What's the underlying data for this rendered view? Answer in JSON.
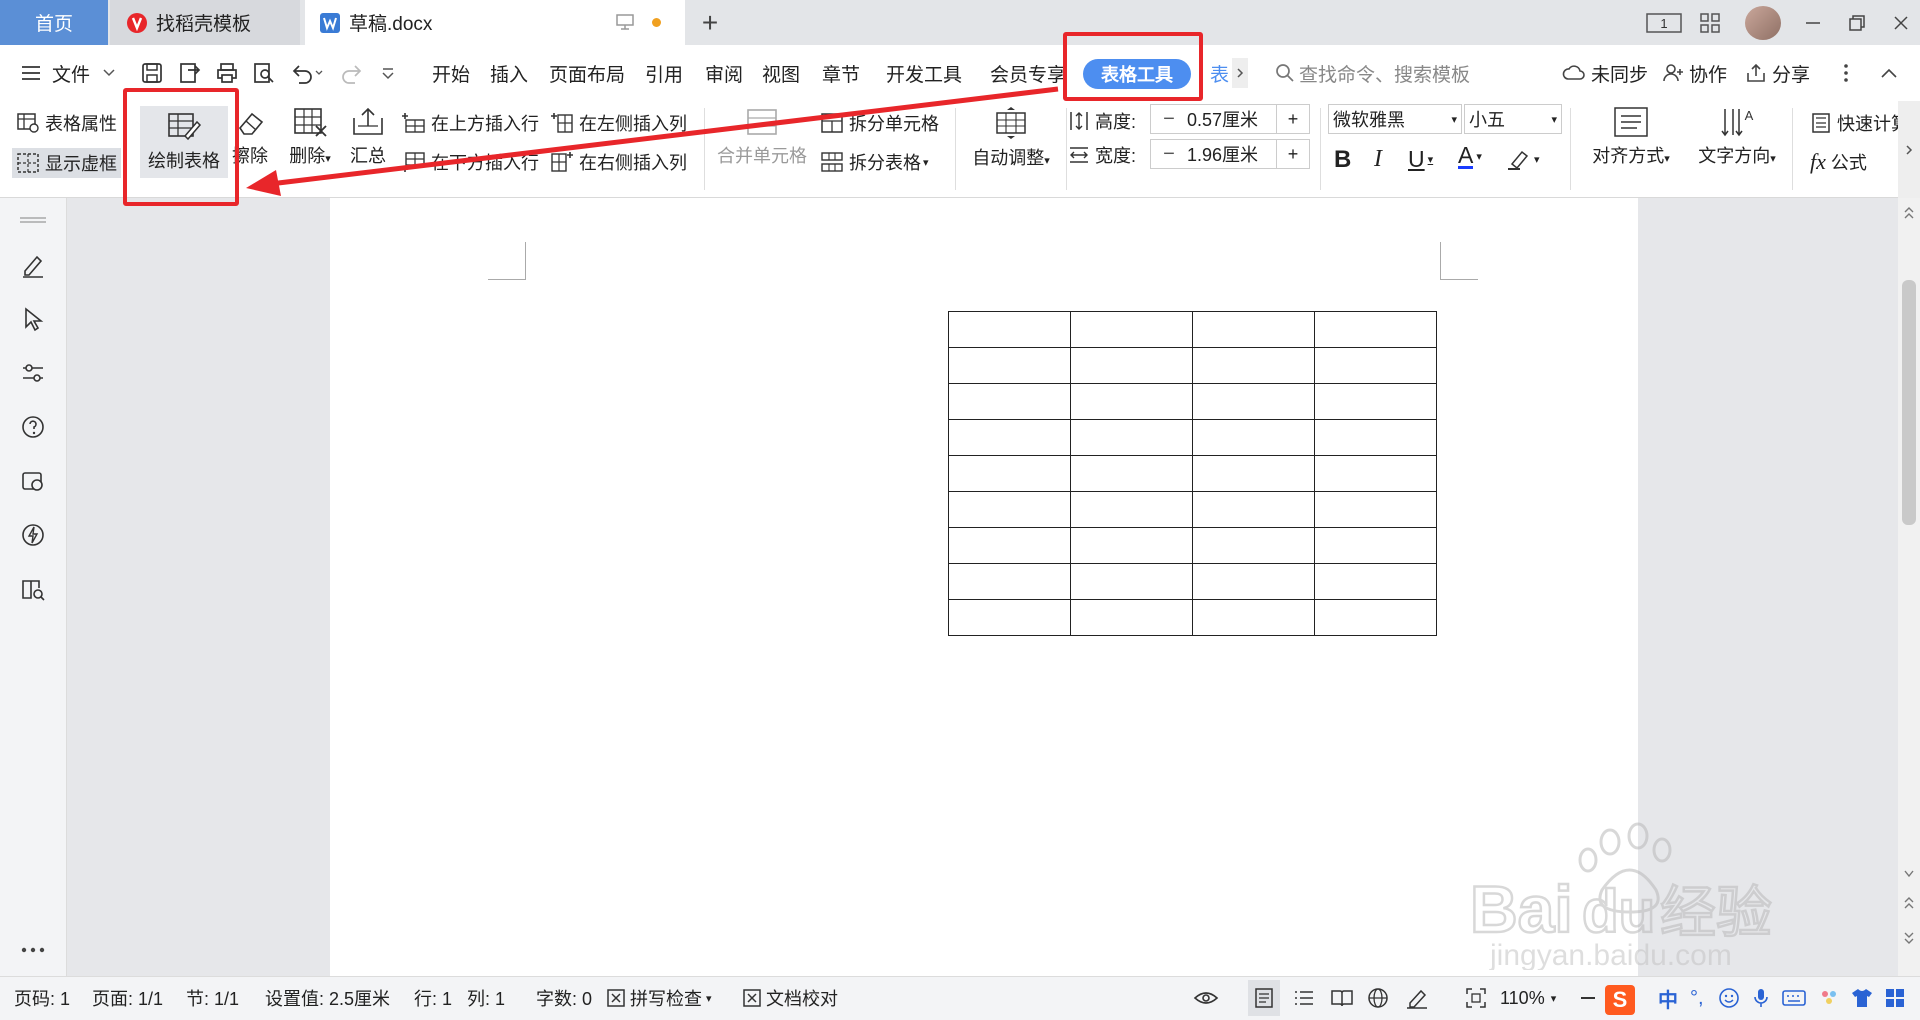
{
  "tabs": {
    "home": "首页",
    "templates": "找稻壳模板",
    "document": "草稿.docx",
    "add": "+"
  },
  "window": {
    "page_badge": "1"
  },
  "menu": {
    "file": "文件",
    "items": [
      "开始",
      "插入",
      "页面布局",
      "引用",
      "审阅",
      "视图",
      "章节",
      "开发工具",
      "会员专享"
    ],
    "active_tab": "表格工具",
    "next_tab": "表",
    "search_placeholder": "查找命令、搜索模板",
    "sync": "未同步",
    "collab": "协作",
    "share": "分享"
  },
  "ribbon": {
    "table_props": "表格属性",
    "show_gridlines": "显示虚框",
    "draw_table": "绘制表格",
    "erase": "擦除",
    "delete": "删除",
    "summary": "汇总",
    "insert_row_above": "在上方插入行",
    "insert_row_below": "在下方插入行",
    "insert_col_left": "在左侧插入列",
    "insert_col_right": "在右侧插入列",
    "merge_cells": "合并单元格",
    "split_cells": "拆分单元格",
    "split_table": "拆分表格",
    "auto_fit": "自动调整",
    "height_label": "高度:",
    "height_value": "0.57厘米",
    "width_label": "宽度:",
    "width_value": "1.96厘米",
    "font_name": "微软雅黑",
    "font_size": "小五",
    "bold": "B",
    "italic": "I",
    "underline": "U",
    "font_color": "A",
    "align": "对齐方式",
    "text_direction": "文字方向",
    "quick_calc": "快速计算",
    "formula": "公式",
    "fx": "fx"
  },
  "table": {
    "rows": 9,
    "cols": 4
  },
  "status": {
    "page_no": "页码: 1",
    "pages": "页面: 1/1",
    "section": "节: 1/1",
    "setting": "设置值: 2.5厘米",
    "row": "行: 1",
    "col": "列: 1",
    "word_count": "字数: 0",
    "spell_check": "拼写检查",
    "doc_proof": "文档校对",
    "zoom": "110%",
    "ime_lang": "中"
  },
  "watermark": {
    "brand": "Bai",
    "brand2": "du",
    "service": "经验",
    "url": "jingyan.baidu.com"
  },
  "colors": {
    "accent": "#5b8fd6",
    "highlight": "#e8262a",
    "active_tab_bg": "#4d8ef0"
  }
}
